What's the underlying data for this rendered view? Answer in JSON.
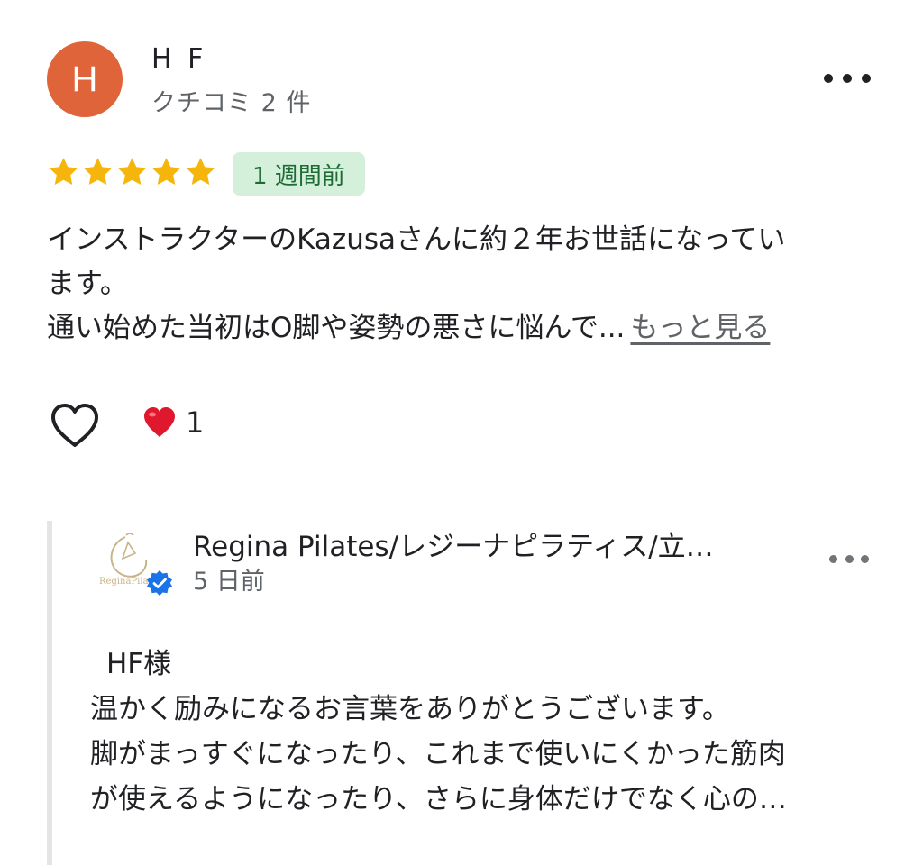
{
  "review": {
    "avatar_letter": "H",
    "reviewer_name": "H F",
    "review_count": "クチコミ 2 件",
    "rating": 5,
    "max_rating": 5,
    "time_ago": "1 週間前",
    "text_lines": [
      "インストラクターのKazusaさんに約２年お世話になってい",
      "ます。"
    ],
    "text_last_line": "通い始めた当初はO脚や姿勢の悪さに悩んで...",
    "read_more": "もっと見る",
    "reaction_count": "1"
  },
  "reply": {
    "owner_name": "Regina Pilates/レジーナピラティス/立…",
    "logo_text": "ReginaPilates",
    "time_ago": "5 日前",
    "lines": [
      "HF様",
      "温かく励みになるお言葉をありがとうございます。",
      "脚がまっすぐになったり、これまで使いにくかった筋肉",
      "が使えるようになったり、さらに身体だけでなく心の…"
    ]
  },
  "colors": {
    "avatar": "#e0643a",
    "star": "#f5b50a",
    "badge_bg": "#d4f0da",
    "badge_text": "#1e6b35",
    "verified": "#1a73e8",
    "heart": "#e0182d"
  }
}
